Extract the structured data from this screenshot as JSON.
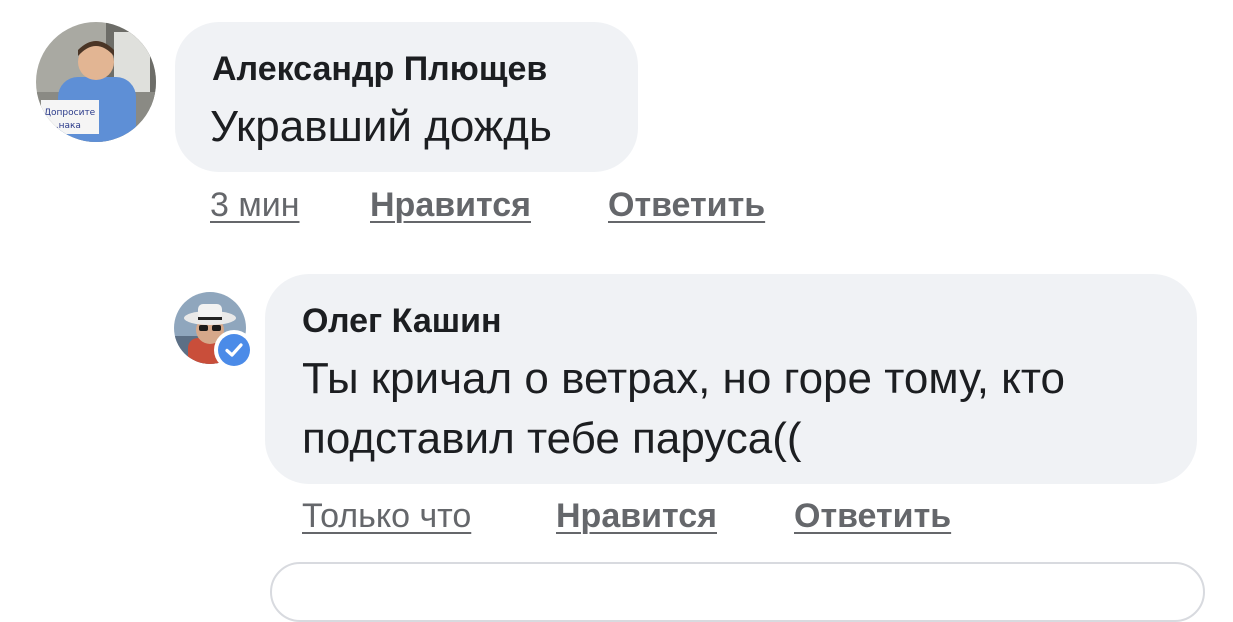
{
  "comments": [
    {
      "author": "Александр Плющев",
      "text": "Укравший дождь",
      "time": "3 мин",
      "like_label": "Нравится",
      "reply_label": "Ответить",
      "avatar_sign_text": "Допросите ...нака"
    },
    {
      "author": "Олег Кашин",
      "text_line1": "Ты кричал о ветрах, но горе тому, кто",
      "text_line2": "подставил тебе паруса((",
      "time": "Только что",
      "like_label": "Нравится",
      "reply_label": "Ответить",
      "verified": true
    }
  ],
  "colors": {
    "bubble": "#f0f2f5",
    "meta_text": "#65676b",
    "body_text": "#1c1e21",
    "verified_badge": "#4b8be8"
  },
  "icons": [
    "avatar-photo",
    "verified-badge-icon",
    "checkmark-icon"
  ]
}
